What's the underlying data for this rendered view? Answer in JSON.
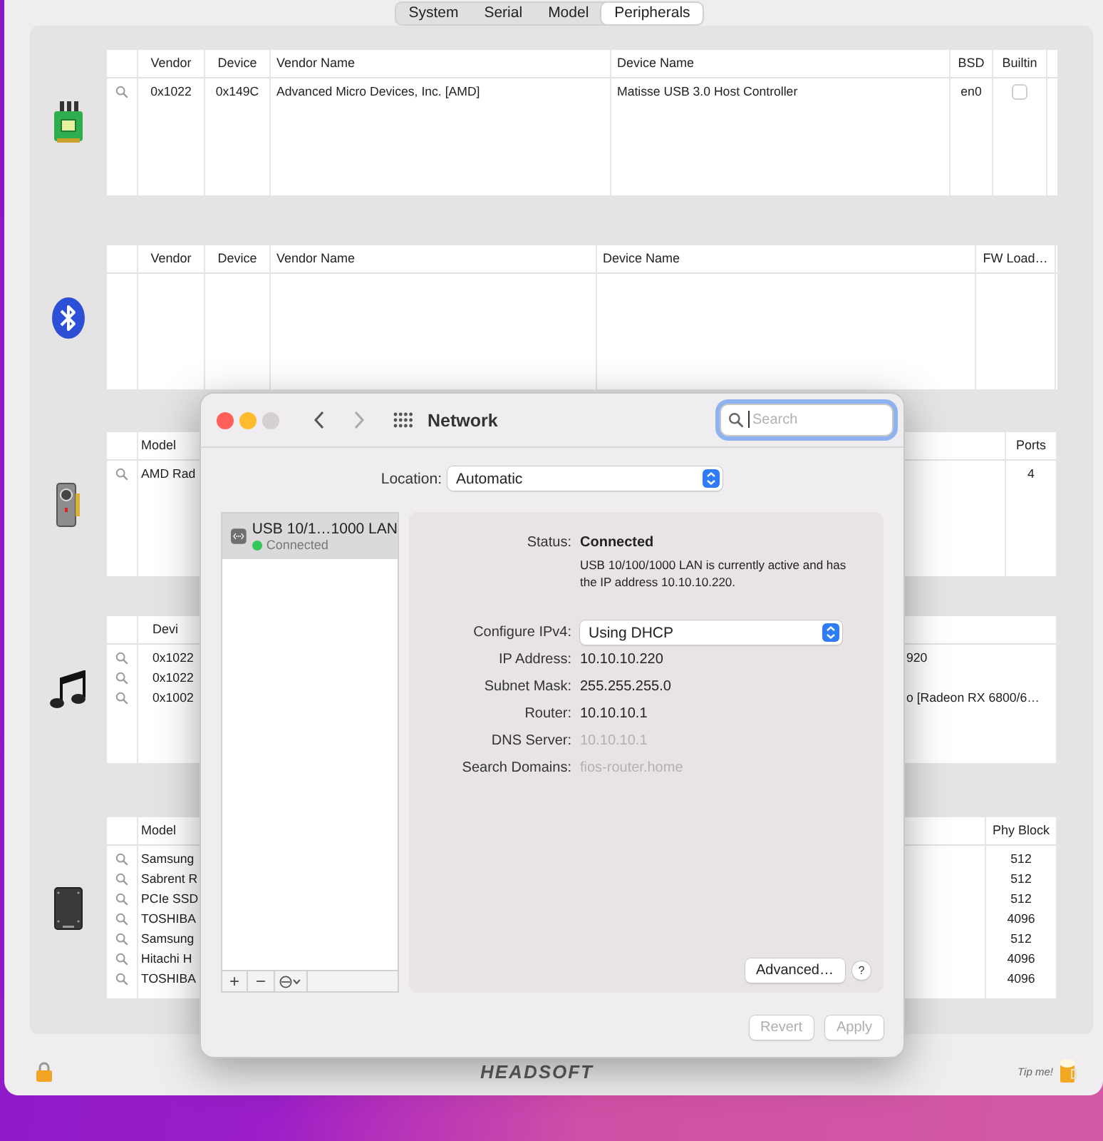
{
  "tabs": [
    {
      "label": "System",
      "selected": false
    },
    {
      "label": "Serial",
      "selected": false
    },
    {
      "label": "Model",
      "selected": false
    },
    {
      "label": "Peripherals",
      "selected": true
    }
  ],
  "sections": [
    {
      "kind": "usb",
      "columns": [
        "Vendor",
        "Device",
        "Vendor Name",
        "Device Name",
        "BSD",
        "Builtin"
      ],
      "rows": [
        {
          "cells": [
            "0x1022",
            "0x149C",
            "Advanced Micro Devices, Inc. [AMD]",
            "Matisse USB 3.0 Host Controller",
            "en0",
            false
          ]
        }
      ]
    },
    {
      "kind": "bluetooth",
      "columns": [
        "Vendor",
        "Device",
        "Vendor Name",
        "Device Name",
        "FW Load…"
      ]
    },
    {
      "kind": "gpu",
      "columns": [
        "Model",
        "Ports"
      ],
      "rows": [
        {
          "cells": [
            "AMD Rad",
            "4"
          ]
        }
      ]
    },
    {
      "kind": "audio",
      "columns": [
        "Devi"
      ],
      "rows": [
        {
          "cells": [
            "0x1022",
            "920"
          ]
        },
        {
          "cells": [
            "0x1022"
          ]
        },
        {
          "cells": [
            "0x1002",
            "o [Radeon RX 6800/6…"
          ]
        }
      ]
    },
    {
      "kind": "storage",
      "columns": [
        "Model",
        "Phy Block"
      ],
      "rows": [
        {
          "cells": [
            "Samsung",
            "512"
          ]
        },
        {
          "cells": [
            "Sabrent R",
            "512"
          ]
        },
        {
          "cells": [
            "PCIe SSD",
            "512"
          ]
        },
        {
          "cells": [
            "TOSHIBA",
            "4096"
          ]
        },
        {
          "cells": [
            "Samsung",
            "512"
          ]
        },
        {
          "cells": [
            "Hitachi H",
            "4096"
          ]
        },
        {
          "cells": [
            "TOSHIBA",
            "4096"
          ]
        }
      ]
    }
  ],
  "footer": {
    "logo": "HEADSOFT",
    "tip": "Tip me!"
  },
  "network": {
    "title": "Network",
    "search": {
      "placeholder": "Search",
      "focused": true
    },
    "location": {
      "label": "Location:",
      "value": "Automatic"
    },
    "services": [
      {
        "name": "USB 10/1…1000 LAN",
        "status": "Connected",
        "color": "#34c759",
        "selected": true
      }
    ],
    "service_buttons": [
      "+",
      "−"
    ],
    "status": {
      "label": "Status:",
      "value": "Connected",
      "description": "USB 10/100/1000 LAN is currently active and has the IP address 10.10.10.220."
    },
    "fields": [
      {
        "label": "Configure IPv4:",
        "value": "Using DHCP",
        "kind": "popup",
        "disabled": false
      },
      {
        "label": "IP Address:",
        "value": "10.10.10.220",
        "kind": "text",
        "disabled": false
      },
      {
        "label": "Subnet Mask:",
        "value": "255.255.255.0",
        "kind": "text",
        "disabled": false
      },
      {
        "label": "Router:",
        "value": "10.10.10.1",
        "kind": "text",
        "disabled": false
      },
      {
        "label": "DNS Server:",
        "value": "10.10.10.1",
        "kind": "text",
        "disabled": true
      },
      {
        "label": "Search Domains:",
        "value": "fios-router.home",
        "kind": "text",
        "disabled": true
      }
    ],
    "advanced": "Advanced…",
    "help": "?",
    "buttons": [
      {
        "label": "Revert",
        "disabled": true
      },
      {
        "label": "Apply",
        "disabled": true
      }
    ]
  }
}
